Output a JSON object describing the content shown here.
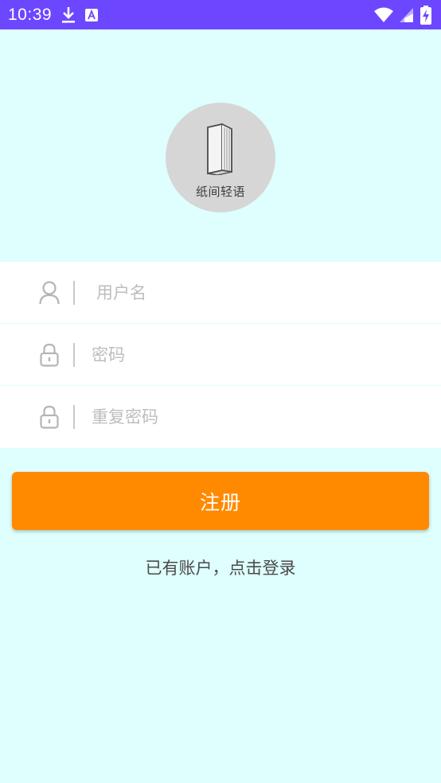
{
  "status_bar": {
    "time": "10:39",
    "icons": [
      "download-icon",
      "font-icon",
      "wifi-icon",
      "signal-icon",
      "battery-charging-icon"
    ],
    "background": "#6c47ff"
  },
  "app": {
    "name": "纸间轻语",
    "logo_icon": "book-icon",
    "background": "#dffefe"
  },
  "form": {
    "username": {
      "placeholder": "用户名",
      "value": "",
      "icon": "user-icon"
    },
    "password": {
      "placeholder": "密码",
      "value": "",
      "icon": "lock-icon"
    },
    "confirm_password": {
      "placeholder": "重复密码",
      "value": "",
      "icon": "lock-icon"
    }
  },
  "actions": {
    "register_label": "注册",
    "register_color": "#ff8a00",
    "login_link": "已有账户，点击登录"
  }
}
